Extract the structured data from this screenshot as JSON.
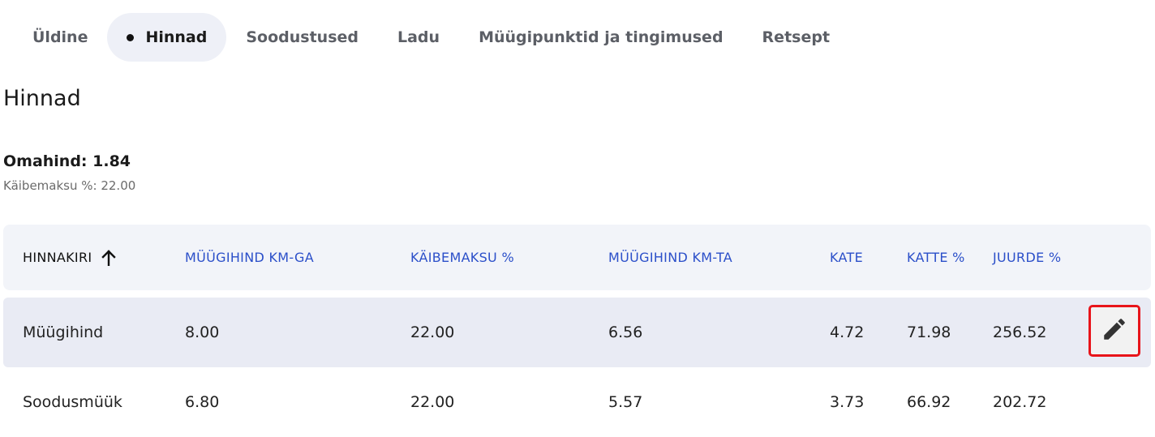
{
  "tabs": [
    {
      "label": "Üldine",
      "active": false
    },
    {
      "label": "Hinnad",
      "active": true
    },
    {
      "label": "Soodustused",
      "active": false
    },
    {
      "label": "Ladu",
      "active": false
    },
    {
      "label": "Müügipunktid ja tingimused",
      "active": false
    },
    {
      "label": "Retsept",
      "active": false
    }
  ],
  "page": {
    "title": "Hinnad",
    "cost_price": "Omahind: 1.84",
    "vat_info": "Käibemaksu %: 22.00"
  },
  "table": {
    "columns": [
      "HINNAKIRI",
      "MÜÜGIHIND KM-GA",
      "KÄIBEMAKSU %",
      "MÜÜGIHIND KM-TA",
      "KATE",
      "KATTE %",
      "JUURDE %"
    ],
    "sorted_column": "HINNAKIRI",
    "sort_direction": "ascending",
    "rows": [
      [
        "Müügihind",
        "8.00",
        "22.00",
        "6.56",
        "4.72",
        "71.98",
        "256.52"
      ],
      [
        "Soodusmüük",
        "6.80",
        "22.00",
        "5.57",
        "3.73",
        "66.92",
        "202.72"
      ]
    ]
  },
  "icons": {
    "sort": "arrow-up-icon",
    "edit": "pencil-icon"
  },
  "colors": {
    "header_link": "#2b4fc9",
    "active_tab_bg": "#eef0f7",
    "highlight_outline": "#e8141a"
  }
}
